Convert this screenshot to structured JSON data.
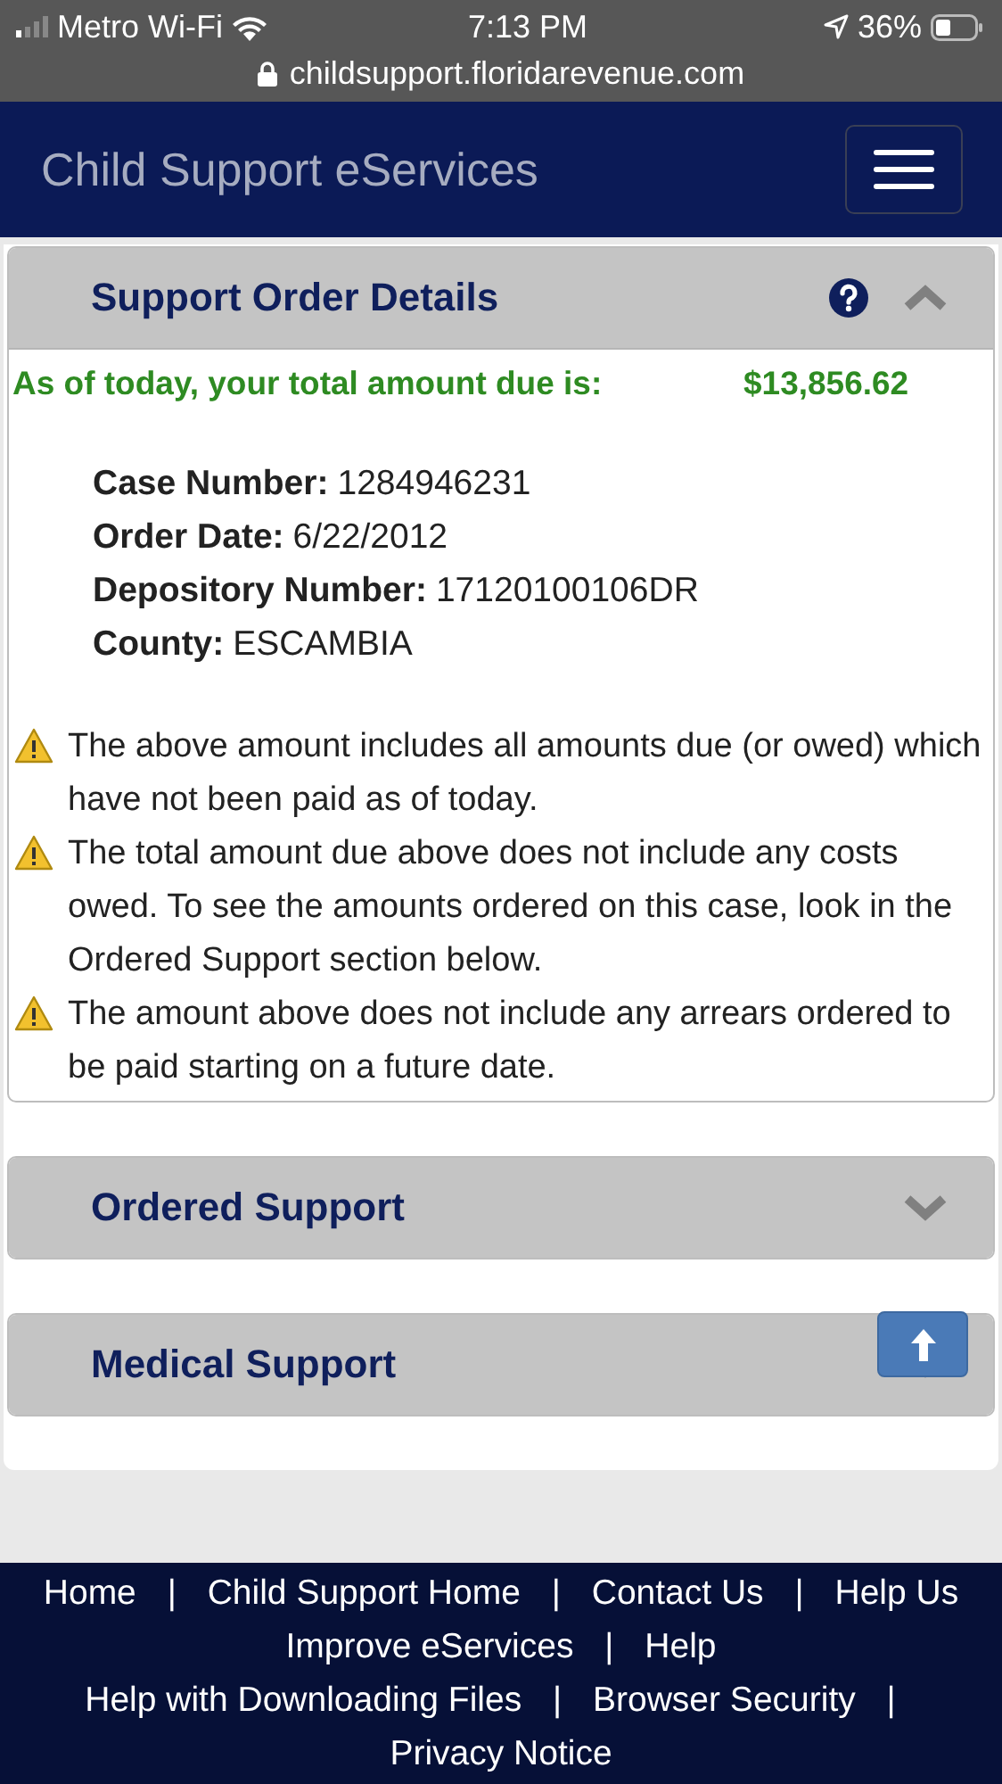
{
  "status_bar": {
    "carrier": "Metro Wi-Fi",
    "time": "7:13 PM",
    "battery": "36%",
    "url": "childsupport.floridarevenue.com"
  },
  "header": {
    "title": "Child Support eServices"
  },
  "panels": [
    {
      "title": "Support Order Details",
      "expanded": true,
      "help": true,
      "summary": {
        "label": "As of today, your total amount due is:",
        "amount": "$13,856.62"
      },
      "fields": [
        {
          "label": "Case Number:",
          "value": "1284946231"
        },
        {
          "label": "Order Date:",
          "value": "6/22/2012"
        },
        {
          "label": "Depository Number:",
          "value": "17120100106DR"
        },
        {
          "label": "County:",
          "value": "ESCAMBIA"
        }
      ],
      "notes": [
        "The above amount includes all amounts due (or owed) which have not been paid as of today.",
        "The total amount due above does not include any costs owed. To see the amounts ordered on this case, look in the Ordered Support section below.",
        "The amount above does not include any arrears ordered to be paid starting on a future date."
      ]
    },
    {
      "title": "Ordered Support",
      "expanded": false,
      "help": false
    },
    {
      "title": "Medical Support",
      "expanded": false,
      "help": false
    }
  ],
  "footer": {
    "links": [
      {
        "text": "Home",
        "separator": "|"
      },
      {
        "text": "Child Support Home",
        "separator": "|"
      },
      {
        "text": "Contact Us",
        "separator": "|"
      },
      {
        "text": "Help Us",
        "line_end": true
      },
      {
        "text": "Improve eServices",
        "separator": "|"
      },
      {
        "text": "Help",
        "line_end": true
      },
      {
        "text": "Help with Downloading Files",
        "separator": "|"
      },
      {
        "text": "Browser Security",
        "separator": "|",
        "line_end": true
      },
      {
        "text": "Privacy Notice"
      }
    ]
  }
}
